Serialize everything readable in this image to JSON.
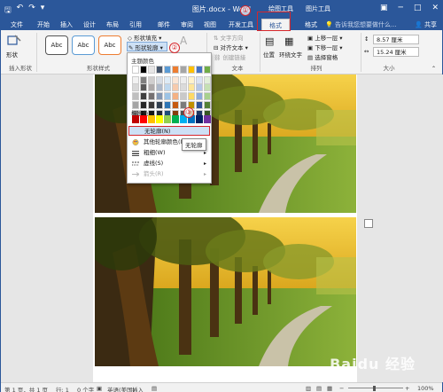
{
  "titlebar": {
    "title": "图片.docx - Word",
    "ctx1": "绘图工具",
    "ctx2": "图片工具"
  },
  "tabs": {
    "file": "文件",
    "home": "开始",
    "insert": "插入",
    "design": "设计",
    "layout": "布局",
    "references": "引用",
    "mailings": "邮件",
    "review": "审阅",
    "view": "视图",
    "developer": "开发工具",
    "format_drawing": "格式",
    "format_picture": "格式",
    "tellme": "告诉我您想要做什么...",
    "share": "共享"
  },
  "ribbon": {
    "shape_label": "形状",
    "insert_shapes_group": "插入形状",
    "shape_styles_group": "形状样式",
    "abc": [
      "Abc",
      "Abc",
      "Abc"
    ],
    "fill": "形状填充",
    "outline": "形状轮廓",
    "text_group": "文本",
    "text_direction": "文字方向",
    "align_text": "对齐文本",
    "create_link": "创建链接",
    "arrange_group": "排列",
    "position": "位置",
    "wrap_text": "环绕文字",
    "bring_forward": "上移一层",
    "send_backward": "下移一层",
    "selection_pane": "选择窗格",
    "size_group": "大小",
    "height": "8.57 厘米",
    "width": "15.24 厘米"
  },
  "menu": {
    "theme_colors": "主题颜色",
    "standard_colors": "标准色",
    "no_outline": "无轮廓(N)",
    "more_colors": "其他轮廓颜色(M)...",
    "weight": "粗细(W)",
    "dashes": "虚线(S)",
    "arrows": "箭头(R)",
    "tooltip": "无轮廓"
  },
  "annotations": [
    "①",
    "②",
    "③"
  ],
  "colors": {
    "theme_top": [
      "#ffffff",
      "#000000",
      "#e7e6e6",
      "#44546a",
      "#5b9bd5",
      "#ed7d31",
      "#a5a5a5",
      "#ffc000",
      "#4472c4",
      "#70ad47"
    ],
    "theme_rows": [
      [
        "#f2f2f2",
        "#7f7f7f",
        "#d0cece",
        "#d6dce4",
        "#deebf6",
        "#fbe5d5",
        "#ededed",
        "#fff2cc",
        "#d9e2f3",
        "#e2efd9"
      ],
      [
        "#d8d8d8",
        "#595959",
        "#aeaaaa",
        "#adb9ca",
        "#bdd7ee",
        "#f7caac",
        "#dbdbdb",
        "#fee599",
        "#b4c6e7",
        "#c5e0b3"
      ],
      [
        "#bfbfbf",
        "#3f3f3f",
        "#757070",
        "#8496b0",
        "#9cc3e5",
        "#f4b183",
        "#c9c9c9",
        "#ffd965",
        "#8eaadb",
        "#a8d08d"
      ],
      [
        "#a5a5a5",
        "#262626",
        "#3a3838",
        "#323f4f",
        "#2e75b5",
        "#c55a11",
        "#7b7b7b",
        "#bf9000",
        "#2f5496",
        "#538135"
      ],
      [
        "#7f7f7f",
        "#0c0c0c",
        "#161616",
        "#222a35",
        "#1e4e79",
        "#833c0b",
        "#525252",
        "#7f6000",
        "#1f3864",
        "#375623"
      ]
    ],
    "standard": [
      "#c00000",
      "#ff0000",
      "#ffc000",
      "#ffff00",
      "#92d050",
      "#00b050",
      "#00b0f0",
      "#0070c0",
      "#002060",
      "#7030a0"
    ]
  },
  "status": {
    "page": "第 1 页，共 1 页",
    "section": "行: 1",
    "words": "0 个字",
    "language": "英语(美国)",
    "mode": "插入",
    "zoom": "100%"
  },
  "watermark": "Baidu 经验"
}
